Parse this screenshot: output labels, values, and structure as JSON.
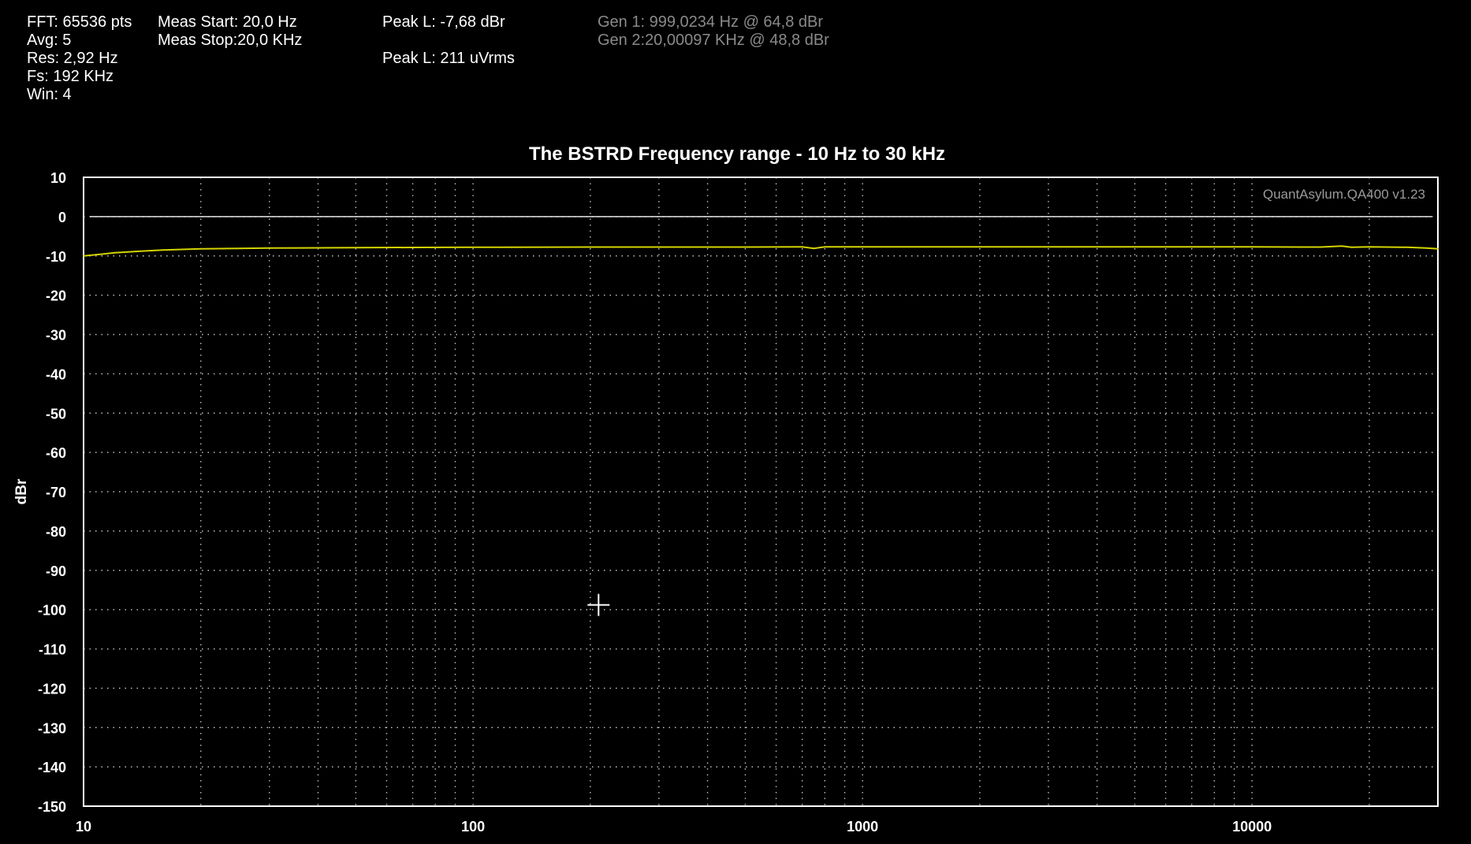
{
  "info": {
    "fft": "FFT: 65536 pts",
    "avg": "Avg: 5",
    "res": "Res: 2,92 Hz",
    "fs": "Fs: 192 KHz",
    "win": "Win: 4",
    "meas_start": "Meas Start: 20,0 Hz",
    "meas_stop": "Meas Stop:20,0 KHz",
    "peak_l_dbr": "Peak L: -7,68 dBr",
    "peak_l_vrms": "Peak L: 211 uVrms",
    "gen1": "Gen 1: 999,0234 Hz @ 64,8  dBr",
    "gen2": "Gen 2:20,00097 KHz @ 48,8  dBr"
  },
  "watermark": "QuantAsylum.QA400 v1.23",
  "colors": {
    "background": "#000000",
    "trace": "#d4d400",
    "reference": "#e6e6e6",
    "grid": "#bfbfbf",
    "axis": "#ffffff",
    "dim_text": "#8a8a8a"
  },
  "chart_data": {
    "type": "line",
    "title": "The BSTRD Frequency range - 10 Hz to 30 kHz",
    "xlabel": "",
    "ylabel": "dBr",
    "xscale": "log",
    "xlim": [
      10,
      30000
    ],
    "ylim": [
      -150,
      10
    ],
    "grid": true,
    "x_ticks": [
      10,
      100,
      1000,
      10000
    ],
    "x_tick_labels": [
      "10",
      "100",
      "1000",
      "10000"
    ],
    "y_ticks": [
      10,
      0,
      -10,
      -20,
      -30,
      -40,
      -50,
      -60,
      -70,
      -80,
      -90,
      -100,
      -110,
      -120,
      -130,
      -140,
      -150
    ],
    "y_tick_labels": [
      "10",
      "0",
      "-10",
      "-20",
      "-30",
      "-40",
      "-50",
      "-60",
      "-70",
      "-80",
      "-90",
      "-100",
      "-110",
      "-120",
      "-130",
      "-140",
      "-150"
    ],
    "reference_line": {
      "y": 0
    },
    "series": [
      {
        "x": [
          10,
          11,
          12,
          14,
          16,
          20,
          25,
          30,
          40,
          50,
          70,
          100,
          200,
          500,
          700,
          750,
          800,
          1000,
          2000,
          5000,
          10000,
          15000,
          17000,
          18000,
          20000,
          25000,
          28000,
          30000
        ],
        "values": [
          -10.0,
          -9.6,
          -9.2,
          -8.8,
          -8.5,
          -8.2,
          -8.1,
          -8.0,
          -7.95,
          -7.9,
          -7.85,
          -7.8,
          -7.75,
          -7.75,
          -7.7,
          -8.1,
          -7.7,
          -7.7,
          -7.7,
          -7.7,
          -7.7,
          -7.75,
          -7.5,
          -7.8,
          -7.7,
          -7.8,
          -8.0,
          -8.2
        ]
      }
    ]
  },
  "cursor": {
    "x": 210,
    "y": -98.8
  }
}
